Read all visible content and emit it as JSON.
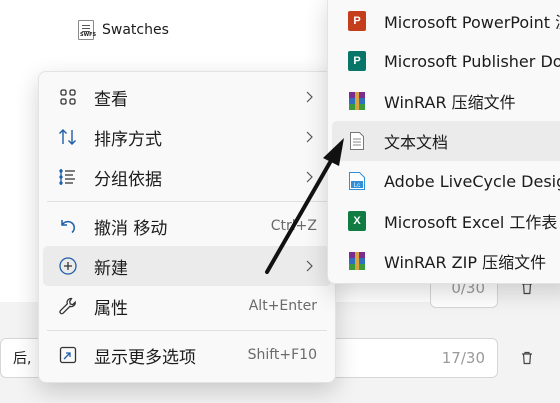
{
  "explorer": {
    "file_name": "Swatches",
    "file_tag": "SWFS"
  },
  "form": {
    "field1_counter": "0/30",
    "field2_text": "后,",
    "field2_counter": "17/30"
  },
  "context_menu": {
    "items": [
      {
        "label": "查看",
        "shortcut": "",
        "has_submenu": true,
        "icon": "grid-icon"
      },
      {
        "label": "排序方式",
        "shortcut": "",
        "has_submenu": true,
        "icon": "sort-icon"
      },
      {
        "label": "分组依据",
        "shortcut": "",
        "has_submenu": true,
        "icon": "group-list-icon"
      },
      {
        "label": "撤消 移动",
        "shortcut": "Ctrl+Z",
        "has_submenu": false,
        "icon": "undo-icon"
      },
      {
        "label": "新建",
        "shortcut": "",
        "has_submenu": true,
        "icon": "new-plus-icon"
      },
      {
        "label": "属性",
        "shortcut": "Alt+Enter",
        "has_submenu": false,
        "icon": "wrench-icon"
      },
      {
        "label": "显示更多选项",
        "shortcut": "Shift+F10",
        "has_submenu": false,
        "icon": "more-options-icon"
      }
    ]
  },
  "submenu": {
    "items": [
      {
        "label": "Microsoft PowerPoint 演",
        "icon": "powerpoint-icon"
      },
      {
        "label": "Microsoft Publisher Doc",
        "icon": "publisher-icon"
      },
      {
        "label": "WinRAR 压缩文件",
        "icon": "winrar-icon"
      },
      {
        "label": "文本文档",
        "icon": "text-document-icon"
      },
      {
        "label": "Adobe LiveCycle Design",
        "icon": "livecycle-icon"
      },
      {
        "label": "Microsoft Excel 工作表",
        "icon": "excel-icon"
      },
      {
        "label": "WinRAR ZIP 压缩文件",
        "icon": "winrar-zip-icon"
      }
    ]
  },
  "colors": {
    "powerpoint": "#c43e1c",
    "publisher": "#077568",
    "excel": "#107c41",
    "livecycle": "#2f8fd8",
    "winrar": "#7b2d8e",
    "accent": "#005fb8"
  }
}
